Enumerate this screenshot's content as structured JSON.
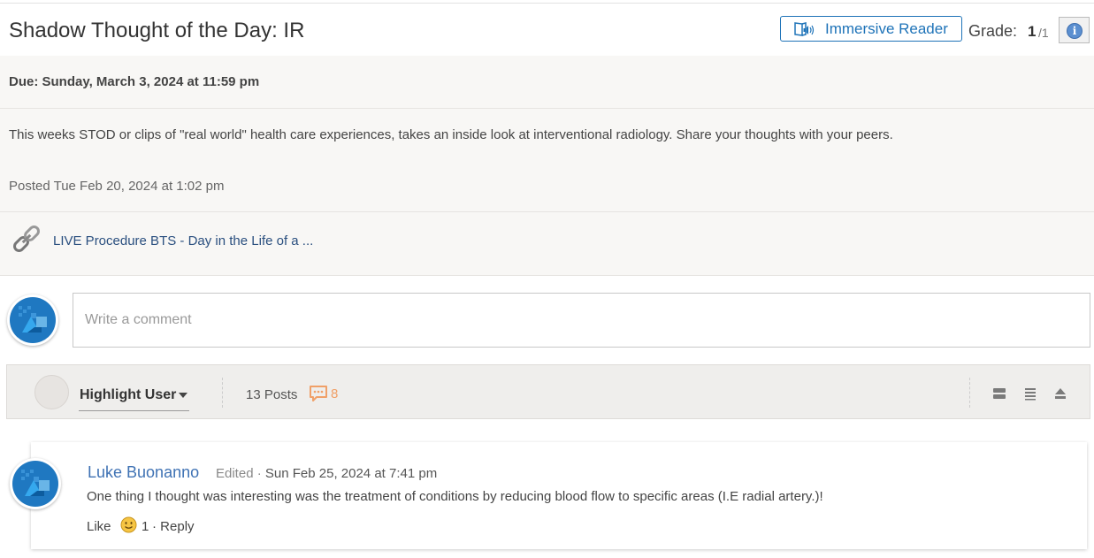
{
  "header": {
    "title": "Shadow Thought of the Day: IR",
    "immersive_reader": "Immersive Reader",
    "grade_label": "Grade:",
    "grade_value": "1",
    "grade_max": "/1",
    "info_icon_char": "i"
  },
  "assignment": {
    "due": "Due: Sunday, March 3, 2024 at 11:59 pm",
    "description": "This weeks STOD or clips of \"real world\" health care experiences, takes an inside look at interventional radiology. Share your thoughts with your peers.",
    "posted": "Posted Tue Feb 20, 2024 at 1:02 pm",
    "link_text": "LIVE Procedure BTS - Day in the Life of a ..."
  },
  "comment_box": {
    "placeholder": "Write a comment"
  },
  "toolbar": {
    "highlight_user": "Highlight User",
    "posts_count": "13 Posts",
    "unread_count": "8"
  },
  "posts": [
    {
      "author": "Luke Buonanno",
      "edited": "Edited",
      "date": "Sun Feb 25, 2024 at 7:41 pm",
      "body": "One thing I thought was interesting was the treatment of conditions by reducing blood flow to specific areas (I.E radial artery.)!",
      "like_label": "Like",
      "like_count": "1",
      "reply_label": "Reply"
    }
  ],
  "colors": {
    "accent_blue": "#1e73b8",
    "author_link": "#3f72b4",
    "unread_orange": "#f0a068",
    "panel_bg": "#f8f7f5"
  }
}
